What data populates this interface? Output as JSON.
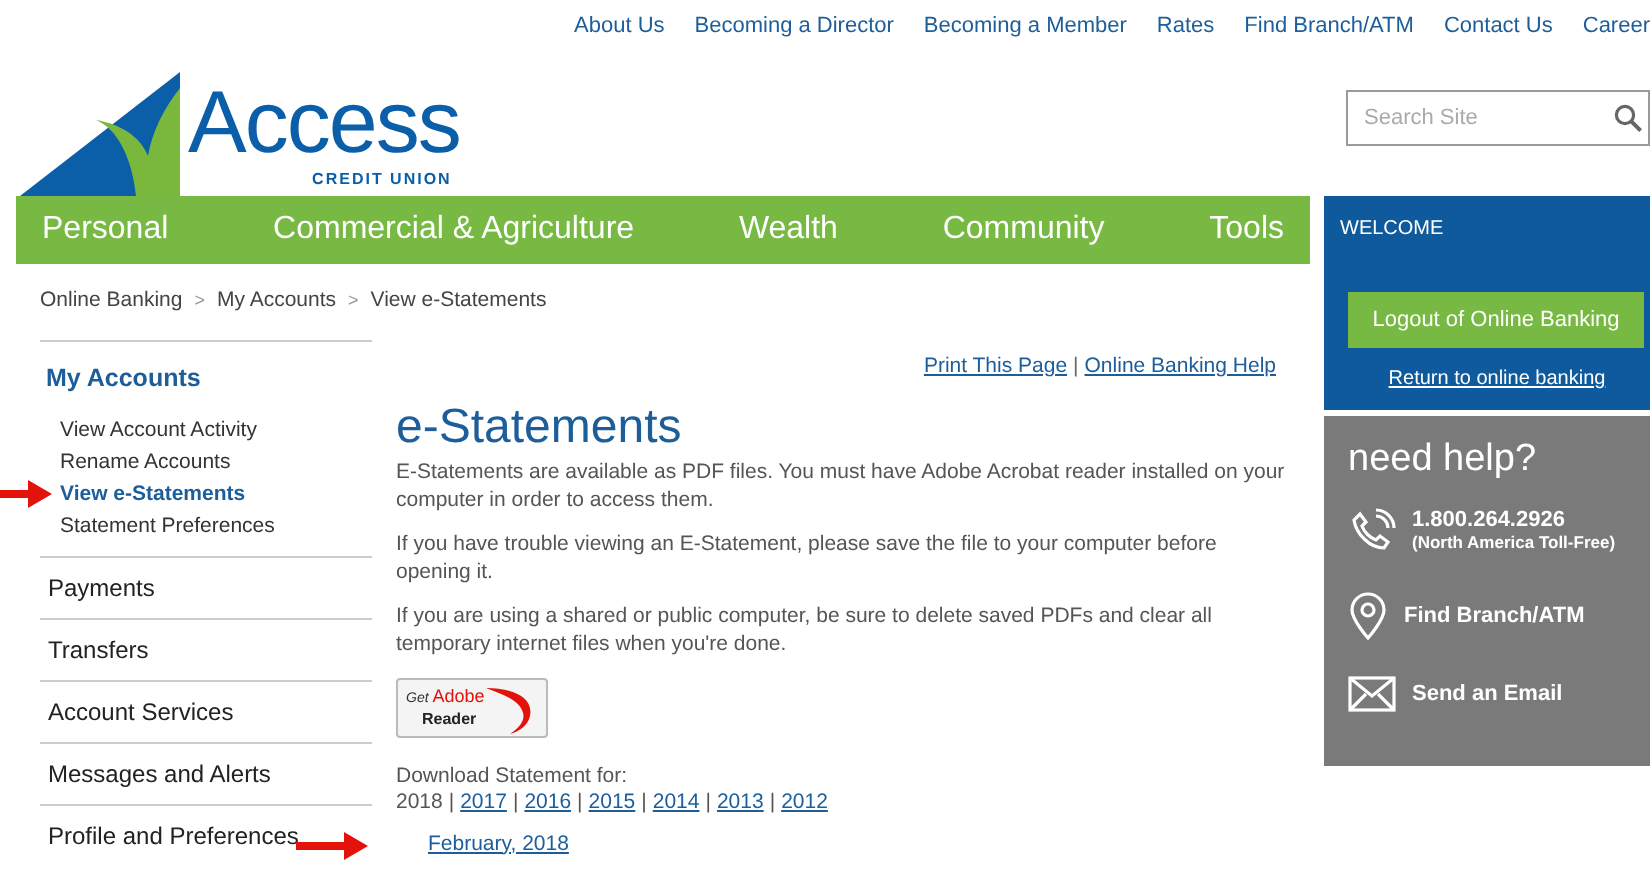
{
  "top_links": [
    "About Us",
    "Becoming a Director",
    "Becoming a Member",
    "Rates",
    "Find Branch/ATM",
    "Contact Us",
    "Career"
  ],
  "logo": {
    "name": "Access",
    "tagline": "CREDIT UNION"
  },
  "search": {
    "placeholder": "Search Site"
  },
  "main_nav": [
    "Personal",
    "Commercial & Agriculture",
    "Wealth",
    "Community",
    "Tools"
  ],
  "welcome": {
    "title": "WELCOME",
    "logout": "Logout of Online Banking",
    "return_link": "Return to online banking"
  },
  "breadcrumb": [
    "Online Banking",
    "My Accounts",
    "View e-Statements"
  ],
  "breadcrumb_separator": ">",
  "link_divider": "|",
  "sidebar": {
    "heading": "My Accounts",
    "subitems": [
      {
        "label": "View Account Activity",
        "selected": false
      },
      {
        "label": "Rename Accounts",
        "selected": false
      },
      {
        "label": "View e-Statements",
        "selected": true
      },
      {
        "label": "Statement Preferences",
        "selected": false
      }
    ],
    "sections": [
      "Payments",
      "Transfers",
      "Account Services",
      "Messages and Alerts",
      "Profile and Preferences"
    ]
  },
  "utility_links": [
    "Print This Page",
    "Online Banking Help"
  ],
  "page_title": "e-Statements",
  "paragraphs": [
    "E-Statements are available as PDF files. You must have Adobe Acrobat reader installed on your computer in order to access them.",
    "If you have trouble viewing an E-Statement, please save the file to your computer before opening it.",
    "If you are using a shared or public computer, be sure to delete saved PDFs and clear all temporary internet files when you're done."
  ],
  "adobe_badge": {
    "get": "Get",
    "brand": "Adobe",
    "product": "Reader"
  },
  "download_label": "Download Statement for:",
  "years": [
    {
      "label": "2018",
      "selected": true
    },
    {
      "label": "2017",
      "selected": false
    },
    {
      "label": "2016",
      "selected": false
    },
    {
      "label": "2015",
      "selected": false
    },
    {
      "label": "2014",
      "selected": false
    },
    {
      "label": "2013",
      "selected": false
    },
    {
      "label": "2012",
      "selected": false
    }
  ],
  "statements": [
    "February, 2018"
  ],
  "help": {
    "title": "need help?",
    "items": [
      {
        "kind": "phone",
        "label": "1.800.264.2926",
        "note": "(North America Toll-Free)"
      },
      {
        "kind": "location",
        "label": "Find Branch/ATM"
      },
      {
        "kind": "email",
        "label": "Send an Email"
      }
    ]
  }
}
